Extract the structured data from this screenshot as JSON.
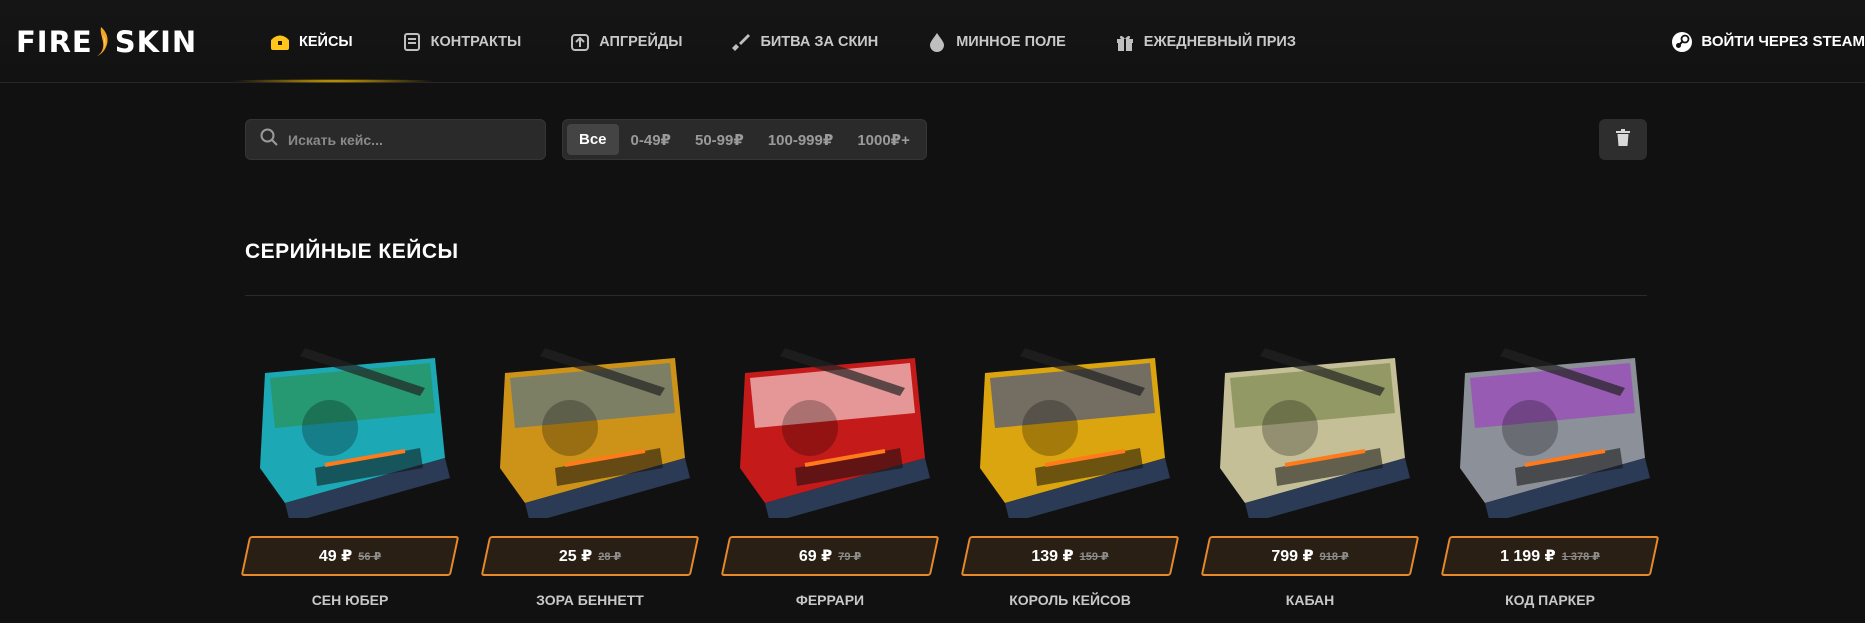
{
  "brand": {
    "logo_left": "FIRE",
    "logo_right": "SKIN"
  },
  "nav": [
    {
      "label": "КЕЙСЫ",
      "icon": "chest-icon",
      "active": true
    },
    {
      "label": "КОНТРАКТЫ",
      "icon": "contract-icon",
      "active": false
    },
    {
      "label": "АПГРЕЙДЫ",
      "icon": "upgrade-icon",
      "active": false
    },
    {
      "label": "БИТВА ЗА СКИН",
      "icon": "sword-icon",
      "active": false
    },
    {
      "label": "МИННОЕ ПОЛЕ",
      "icon": "mine-icon",
      "active": false
    },
    {
      "label": "ЕЖЕДНЕВНЫЙ ПРИЗ",
      "icon": "gift-icon",
      "active": false
    }
  ],
  "login": {
    "label": "ВОЙТИ ЧЕРЕЗ STEAM",
    "icon": "steam-icon"
  },
  "search": {
    "placeholder": "Искать кейс..."
  },
  "price_filter": [
    {
      "label": "Все",
      "active": true
    },
    {
      "label": "0-49₽",
      "active": false
    },
    {
      "label": "50-99₽",
      "active": false
    },
    {
      "label": "100-999₽",
      "active": false
    },
    {
      "label": "1000₽+",
      "active": false
    }
  ],
  "section": {
    "title": "СЕРИЙНЫЕ КЕЙСЫ"
  },
  "cases": [
    {
      "name": "СЕН ЮБЕР",
      "price": "49 ₽",
      "old_price": "56 ₽",
      "theme": "#1fb9c9",
      "accent": "#2d8a3a"
    },
    {
      "name": "ЗОРА БЕННЕТТ",
      "price": "25 ₽",
      "old_price": "28 ₽",
      "theme": "#e2a21a",
      "accent": "#3b6fa3"
    },
    {
      "name": "ФЕРРАРИ",
      "price": "69 ₽",
      "old_price": "79 ₽",
      "theme": "#d91c1c",
      "accent": "#ffffff"
    },
    {
      "name": "КОРОЛЬ КЕЙСОВ",
      "price": "139 ₽",
      "old_price": "159 ₽",
      "theme": "#f2b60f",
      "accent": "#1d3fa8"
    },
    {
      "name": "КАБАН",
      "price": "799 ₽",
      "old_price": "918 ₽",
      "theme": "#d9d3a6",
      "accent": "#6a7a3a"
    },
    {
      "name": "КОД ПАРКЕР",
      "price": "1 199 ₽",
      "old_price": "1 378 ₽",
      "theme": "#9a9fa8",
      "accent": "#a030c8"
    }
  ]
}
